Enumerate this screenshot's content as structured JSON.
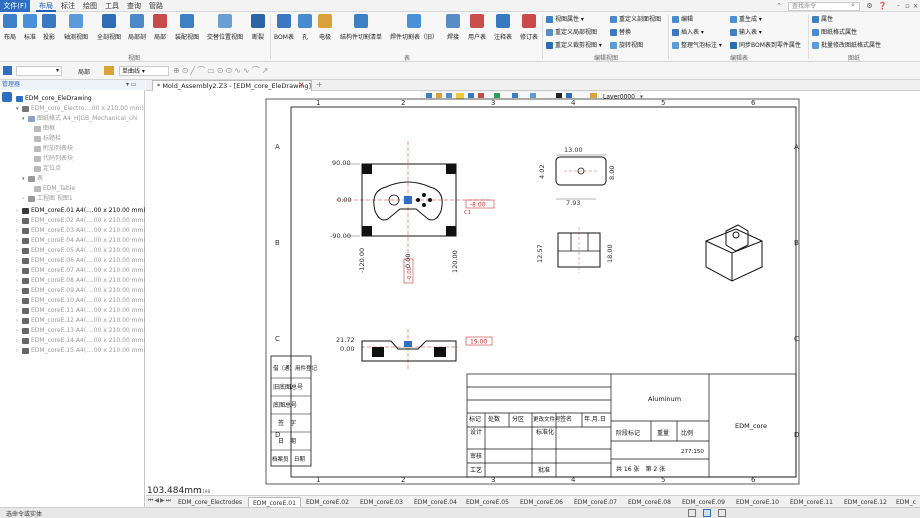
{
  "menubar": {
    "file": "文件(F)",
    "items": [
      "布局",
      "标注",
      "绘图",
      "工具",
      "查询",
      "管路"
    ],
    "search_placeholder": "查找命令"
  },
  "ribbon": {
    "view_buttons": [
      "布局",
      "标准",
      "投影",
      "轴测视图",
      "全剖视图",
      "局部剖",
      "局部",
      "装配视图",
      "交替位置视图",
      "断裂"
    ],
    "table_buttons": [
      "BOM表",
      "孔",
      "电极",
      "结构件切割清单",
      "焊件切割表（旧）",
      "焊接",
      "用户表",
      "注释表",
      "修订表"
    ],
    "edit_col1": [
      "视图属性",
      "重定义局部视图",
      "重定义裁剪视图"
    ],
    "edit_col2": [
      "重定义剖面视图",
      "替换",
      "旋转视图"
    ],
    "edit_col3": [
      "编辑",
      "插入表",
      "整理气泡标注"
    ],
    "edit_col4": [
      "重生成",
      "输入表",
      "同步BOM表到零件属性"
    ],
    "sheet_col": [
      "属性",
      "图纸格式属性",
      "批量修改图纸格式属性"
    ],
    "groups": {
      "view": "视图",
      "table": "表",
      "edit_view": "编辑视图",
      "edit_table": "编辑表",
      "sheet": "图纸"
    }
  },
  "toolbar2": {
    "local": "局部",
    "line": "单曲线"
  },
  "panel": {
    "title": "管理器",
    "tree": [
      {
        "label": "EDM_core_EleDrawing",
        "dim": false
      },
      {
        "label": "EDM_core_Electro....00 x 210.00 mm)",
        "dim": true
      },
      {
        "label": "图纸格式 A4_H|GB_Mechanical_chi",
        "dim": true
      },
      {
        "label": "图框",
        "dim": true
      },
      {
        "label": "标题栏",
        "dim": true
      },
      {
        "label": "附加列表块",
        "dim": true
      },
      {
        "label": "代码列表块",
        "dim": true
      },
      {
        "label": "定位点",
        "dim": true
      },
      {
        "label": "表",
        "dim": true
      },
      {
        "label": "EDM_Table",
        "dim": true
      },
      {
        "label": "工程图 视图1",
        "dim": true
      },
      {
        "label": "EDM_coreE.01 A4(....00 x 210.00 mm)",
        "dim": false
      },
      {
        "label": "EDM_coreE.02 A4(....00 x 210.00 mm)",
        "dim": true
      },
      {
        "label": "EDM_coreE.03 A4(....00 x 210.00 mm)",
        "dim": true
      },
      {
        "label": "EDM_coreE.04 A4(....00 x 210.00 mm)",
        "dim": true
      },
      {
        "label": "EDM_coreE.05 A4(....00 x 210.00 mm)",
        "dim": true
      },
      {
        "label": "EDM_coreE.06 A4(....00 x 210.00 mm)",
        "dim": true
      },
      {
        "label": "EDM_coreE.07 A4(....00 x 210.00 mm)",
        "dim": true
      },
      {
        "label": "EDM_coreE.08 A4(....00 x 210.00 mm)",
        "dim": true
      },
      {
        "label": "EDM_coreE.09 A4(....00 x 210.00 mm)",
        "dim": true
      },
      {
        "label": "EDM_coreE.10 A4(....00 x 210.00 mm)",
        "dim": true
      },
      {
        "label": "EDM_coreE.11 A4(....00 x 210.00 mm)",
        "dim": true
      },
      {
        "label": "EDM_coreE.12 A4(....00 x 210.00 mm)",
        "dim": true
      },
      {
        "label": "EDM_coreE.13 A4(....00 x 210.00 mm)",
        "dim": true
      },
      {
        "label": "EDM_coreE.14 A4(....00 x 210.00 mm)",
        "dim": true
      },
      {
        "label": "EDM_coreE.15 A4(....00 x 210.00 mm)",
        "dim": true
      }
    ]
  },
  "doc_tab": "* Mold_Assembly2.Z3 - [EDM_core_EleDrawing]",
  "layer": "Layer0000",
  "drawing": {
    "col_nums": [
      "1",
      "2",
      "3",
      "4",
      "5",
      "6"
    ],
    "row_letters": [
      "A",
      "B",
      "C",
      "D"
    ],
    "dims_top": {
      "top_w": "13.00",
      "h1": "4.02",
      "h2": "8.00",
      "w2": "7.93",
      "h3": "12.57",
      "h4": "18.00"
    },
    "dims_front": {
      "y1": "90.00",
      "y0": "0.00",
      "y2": "-90.00",
      "x1": "-120.00",
      "x0": "0.00",
      "x2": "120.00",
      "tag1": "-8.00",
      "tag2": "C1",
      "tag3": "-0.00"
    },
    "dims_side": {
      "a": "21.72",
      "b": "0.00",
      "tag": "19.00"
    },
    "left_block": [
      "借（通）用件登记",
      "旧底图总号",
      "底图总号",
      "签　字",
      "日　期",
      "档案员　日期"
    ],
    "title_block": {
      "material": "Aluminum",
      "name": "EDM_core",
      "hdr": [
        "标记",
        "处数",
        "分区",
        "更改文件号",
        "签名",
        "年.月.日"
      ],
      "rows": [
        "设计",
        "审核",
        "工艺"
      ],
      "std": "标准化",
      "approve": "批准",
      "stage": "阶段标记",
      "weight": "重量",
      "scale": "比例",
      "scale_val": "277:150",
      "sheets": "共 16 张　第 2 张"
    }
  },
  "coord_readout": "103.484mm",
  "coord_small": "77.198",
  "sheet_tabs": [
    "EDM_core_Electrodes",
    "EDM_coreE.01",
    "EDM_coreE.02",
    "EDM_coreE.03",
    "EDM_coreE.04",
    "EDM_coreE.05",
    "EDM_coreE.06",
    "EDM_coreE.07",
    "EDM_coreE.08",
    "EDM_coreE.09",
    "EDM_coreE.10",
    "EDM_coreE.11",
    "EDM_coreE.12",
    "EDM_c"
  ],
  "status": "选命令或实体"
}
